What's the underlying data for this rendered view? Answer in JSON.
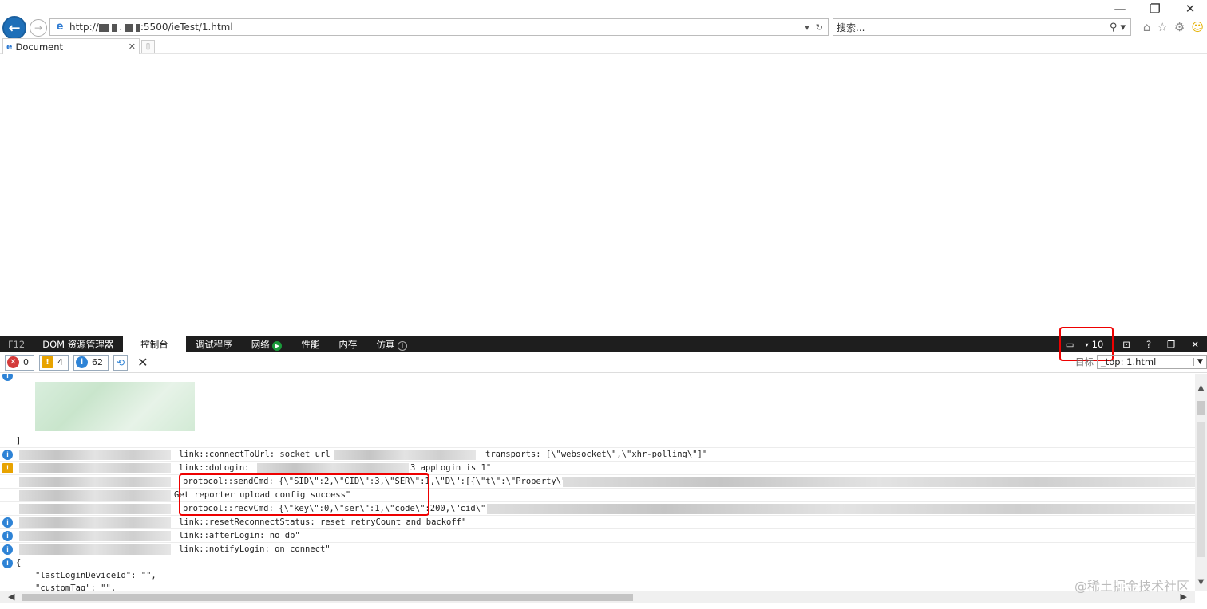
{
  "browser": {
    "url": "http://██   . █   :5500/ieTest/1.html",
    "url_visible_suffix": "5500/ieTest/1.html",
    "search_placeholder": "搜索...",
    "tab_title": "Document"
  },
  "devtools": {
    "f12_label": "F12",
    "tabs": [
      "DOM 资源管理器",
      "控制台",
      "调试程序",
      "网络",
      "性能",
      "内存",
      "仿真"
    ],
    "active_tab": "控制台",
    "emulation_mode": "10",
    "help": "?",
    "counts": {
      "errors": "0",
      "warnings": "4",
      "info": "62"
    },
    "target_label": "目标",
    "target_value": "_top: 1.html"
  },
  "console": {
    "rows": [
      {
        "type": "text",
        "text": "]"
      },
      {
        "type": "info",
        "text": "link::connectToUrl: socket url",
        "text2": "transports: [\\\"websocket\\\",\\\"xhr-polling\\\"]\""
      },
      {
        "type": "warn",
        "text": "link::doLogin:",
        "text2": "3 appLogin is 1\""
      },
      {
        "type": "none",
        "text": "protocol::sendCmd: {\\\"SID\\\":2,\\\"CID\\\":3,\\\"SER\\\":1,\\\"D\\\":[{\\\"t\\\":\\\"Property\\\",\\\""
      },
      {
        "type": "none",
        "text": "Get reporter upload config success\""
      },
      {
        "type": "none",
        "text": "protocol::recvCmd: {\\\"key\\\":0,\\\"ser\\\":1,\\\"code\\\":200,\\\"cid\\\":3,\\\""
      },
      {
        "type": "info",
        "text": "link::resetReconnectStatus: reset retryCount and backoff\""
      },
      {
        "type": "info",
        "text": "link::afterLogin: no db\""
      },
      {
        "type": "info",
        "text": "link::notifyLogin: on connect\""
      },
      {
        "type": "info",
        "text": "{"
      },
      {
        "type": "text",
        "text": "\"lastLoginDeviceId\": \"\","
      },
      {
        "type": "text",
        "text": "\"customTag\": \"\","
      }
    ]
  },
  "watermark": "@稀土掘金技术社区",
  "colors": {
    "devtools_bg": "#1e1e1e",
    "highlight": "#e00000",
    "info": "#2e83d6",
    "warn": "#e8a300",
    "error": "#d43a3a"
  }
}
